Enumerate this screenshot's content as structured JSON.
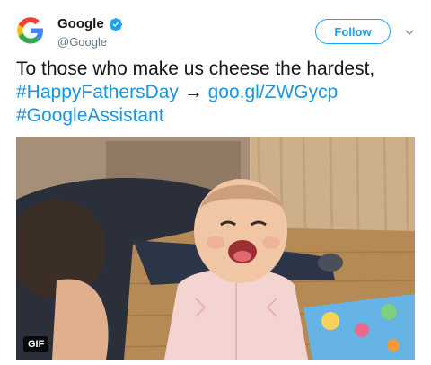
{
  "author": {
    "display_name": "Google",
    "handle": "@Google",
    "verified": true,
    "avatar_icon": "google-g-logo"
  },
  "header": {
    "follow_label": "Follow",
    "menu_icon": "chevron-down-icon"
  },
  "tweet": {
    "line1": "To those who make us cheese the hardest,",
    "hashtag1": "#HappyFathersDay",
    "arrow": "→",
    "link": "goo.gl/ZWGycp",
    "hashtag2": "#GoogleAssistant"
  },
  "media": {
    "badge": "GIF"
  },
  "colors": {
    "link": "#1b95e0",
    "follow": "#1da1f2",
    "text": "#14171a",
    "muted": "#657786"
  }
}
